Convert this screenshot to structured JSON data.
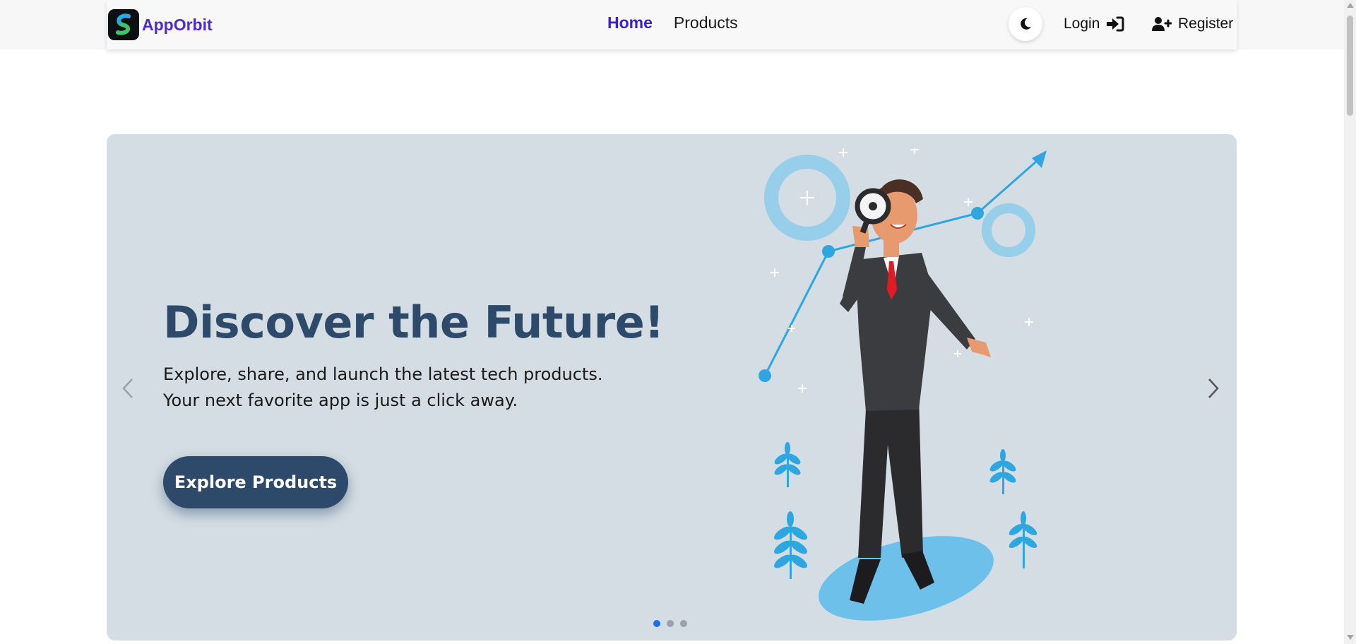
{
  "navbar": {
    "brand": "AppOrbit",
    "links": [
      {
        "label": "Home",
        "active": true
      },
      {
        "label": "Products",
        "active": false
      }
    ],
    "theme_toggle_icon": "moon-icon",
    "login_label": "Login",
    "login_icon": "sign-in-icon",
    "register_label": "Register",
    "register_icon": "user-plus-icon"
  },
  "hero": {
    "title": "Discover the Future!",
    "subtitle": "Explore, share, and launch the latest tech products. Your next favorite app is just a click away.",
    "cta_label": "Explore Products",
    "slide_count": 3,
    "active_slide": 1
  },
  "colors": {
    "brand": "#4c2bd6",
    "hero_bg": "#d4dde3",
    "hero_title": "#2d4a6b",
    "cta_bg": "#2d4a6b",
    "accent_blue": "#2ea6e0",
    "active_dot": "#1a6ef0"
  }
}
